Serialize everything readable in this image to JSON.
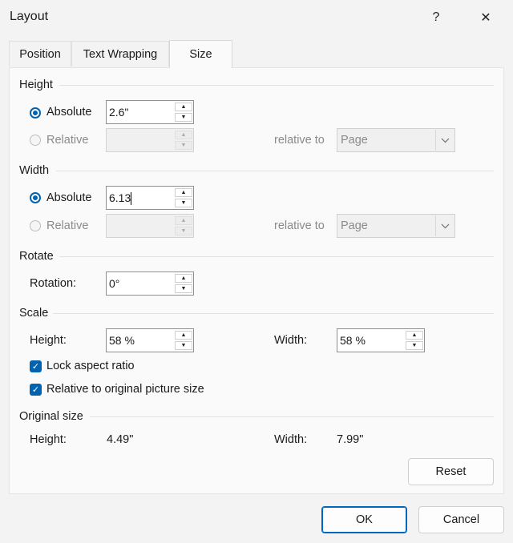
{
  "window": {
    "title": "Layout",
    "help_label": "?",
    "close_label": "✕"
  },
  "tabs": [
    {
      "label": "Position",
      "active": false
    },
    {
      "label": "Text Wrapping",
      "active": false
    },
    {
      "label": "Size",
      "active": true
    }
  ],
  "height": {
    "section": "Height",
    "absolute_label": "Absolute",
    "absolute_value": "2.6\"",
    "relative_label": "Relative",
    "relative_value": "",
    "relative_to_label": "relative to",
    "relative_to_value": "Page"
  },
  "width": {
    "section": "Width",
    "absolute_label": "Absolute",
    "absolute_value": "6.13",
    "relative_label": "Relative",
    "relative_value": "",
    "relative_to_label": "relative to",
    "relative_to_value": "Page"
  },
  "rotate": {
    "section": "Rotate",
    "rotation_label": "Rotation:",
    "rotation_value": "0°"
  },
  "scale": {
    "section": "Scale",
    "height_label": "Height:",
    "height_value": "58 %",
    "width_label": "Width:",
    "width_value": "58 %",
    "lock_aspect_label": "Lock aspect ratio",
    "lock_aspect_checked": true,
    "relative_original_label": "Relative to original picture size",
    "relative_original_checked": true
  },
  "original_size": {
    "section": "Original size",
    "height_label": "Height:",
    "height_value": "4.49\"",
    "width_label": "Width:",
    "width_value": "7.99\"",
    "reset_label": "Reset"
  },
  "footer": {
    "ok_label": "OK",
    "cancel_label": "Cancel"
  },
  "icons": {
    "spin_up": "spin-up-arrow-icon",
    "spin_down": "spin-down-arrow-icon",
    "dropdown": "chevron-down-icon",
    "check": "checkmark-icon"
  },
  "colors": {
    "accent": "#0063b1",
    "dialog_bg": "#f3f3f3",
    "panel_bg": "#fafafa"
  }
}
